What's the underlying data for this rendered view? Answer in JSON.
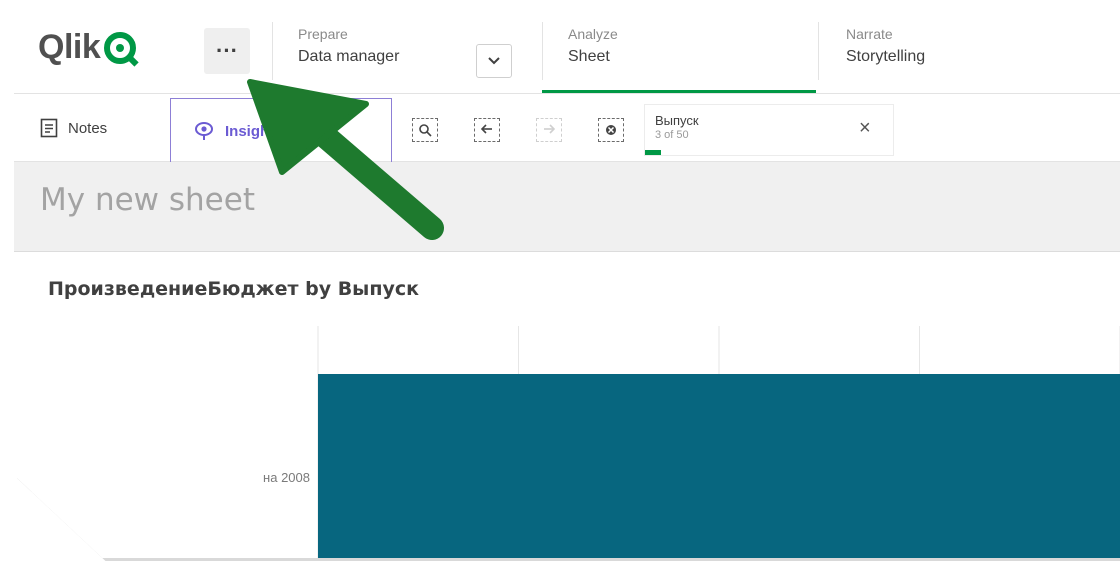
{
  "topbar": {
    "logo_text": "Qlik",
    "more_label": "···",
    "prepare": {
      "sub": "Prepare",
      "main": "Data manager"
    },
    "analyze": {
      "sub": "Analyze",
      "main": "Sheet"
    },
    "narrate": {
      "sub": "Narrate",
      "main": "Storytelling"
    },
    "accent_color": "#009845"
  },
  "toolbar": {
    "notes_label": "Notes",
    "insight_label": "Insight Advisor",
    "icons": [
      "smart-search-icon",
      "step-back-icon",
      "step-forward-icon",
      "clear-selections-icon"
    ],
    "selection": {
      "field": "Выпуск",
      "count": "3 of 50",
      "close": "×"
    }
  },
  "sheet": {
    "title": "My new sheet"
  },
  "chart_data": {
    "type": "bar",
    "orientation": "horizontal",
    "title": "ПроизведениеБюджет by Выпуск",
    "categories": [
      "на 2008"
    ],
    "series": [
      {
        "values": [
          1
        ]
      }
    ],
    "xlim": [
      0,
      1
    ],
    "grid": true,
    "bar_color": "#07667f"
  }
}
